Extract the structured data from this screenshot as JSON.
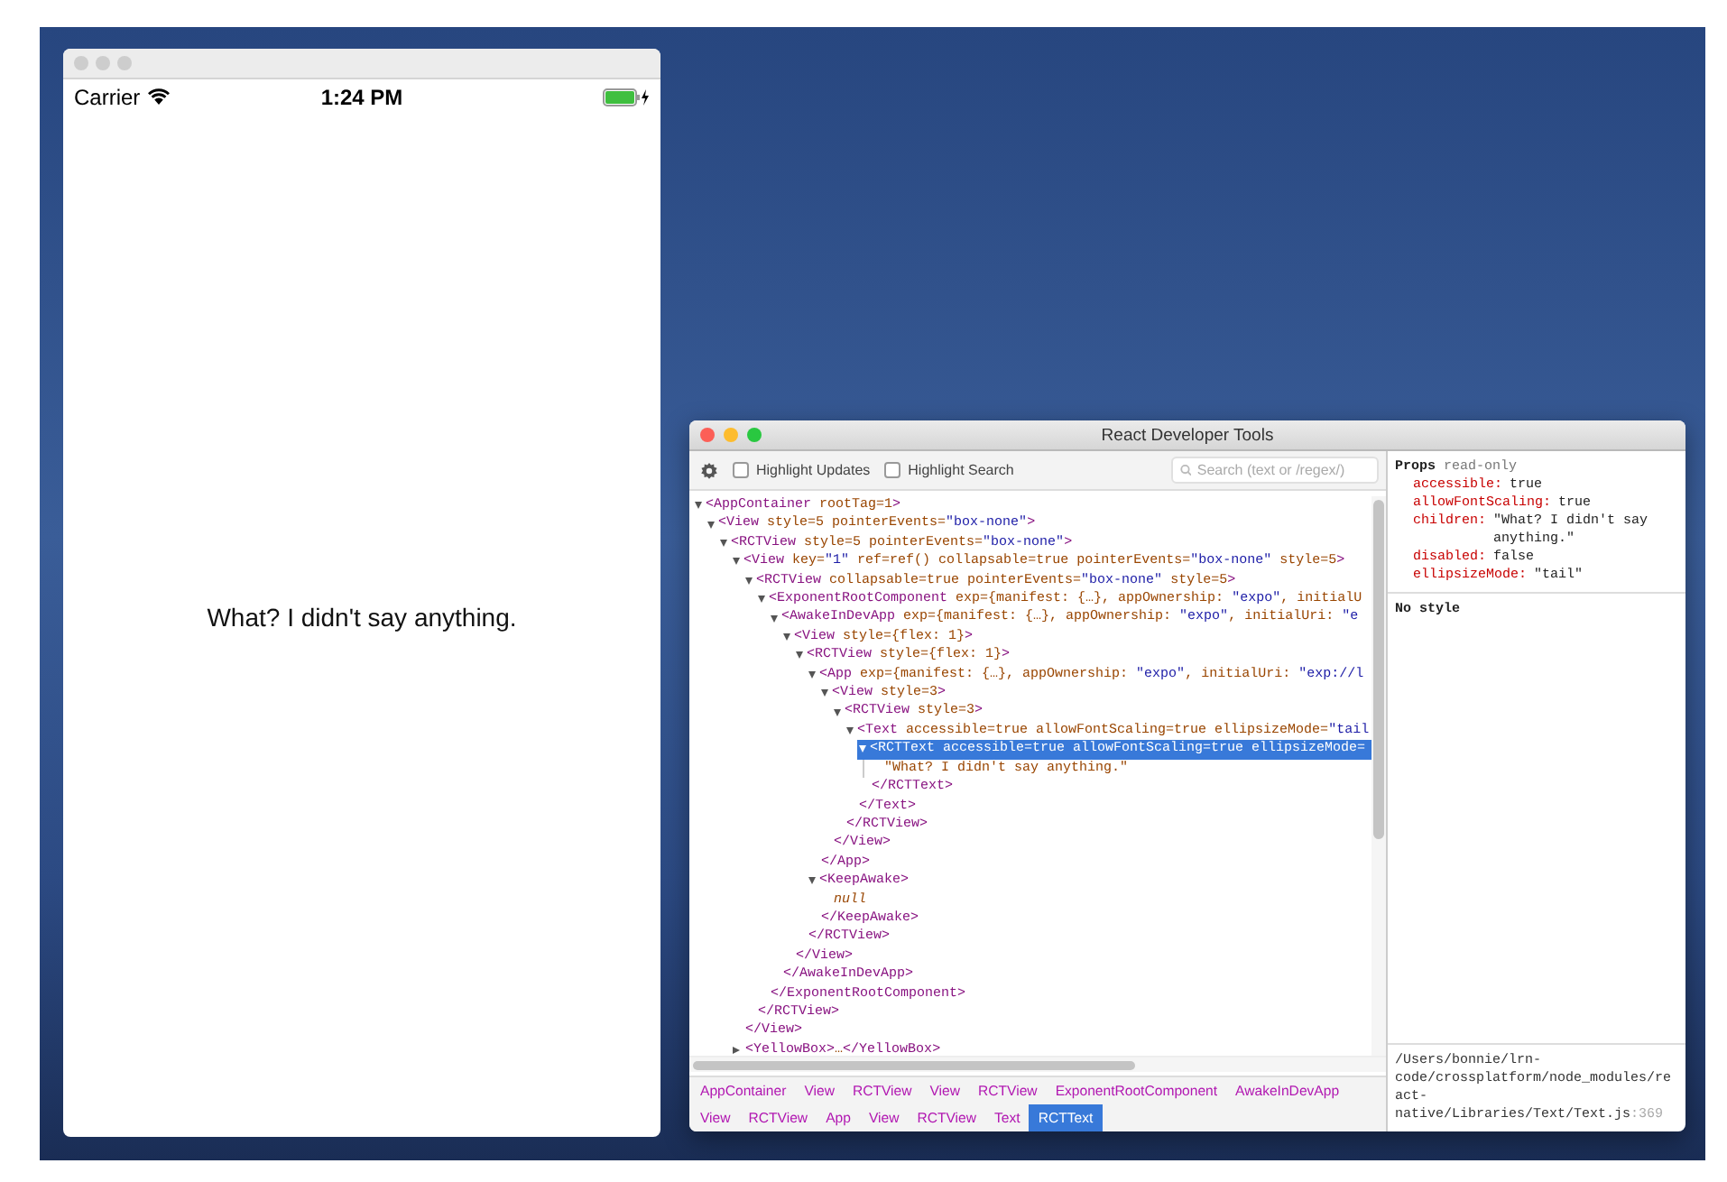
{
  "simulator": {
    "status_bar": {
      "carrier": "Carrier",
      "time": "1:24 PM"
    },
    "content_text": "What? I didn't say anything."
  },
  "devtools": {
    "window": {
      "title": "React Developer Tools"
    },
    "toolbar": {
      "checkboxes": [
        {
          "label": "Highlight Updates",
          "checked": false
        },
        {
          "label": "Highlight Search",
          "checked": false
        }
      ],
      "search": {
        "placeholder": "Search (text or /regex/)"
      }
    },
    "tree": [
      {
        "kind": "element",
        "open": "<AppContainer rootTag=1>",
        "expanded": true,
        "selected": false,
        "children": [
          {
            "kind": "element",
            "open": "<View style=5 pointerEvents=\"box-none\">",
            "expanded": true,
            "selected": false,
            "children": [
              {
                "kind": "element",
                "open": "<RCTView style=5 pointerEvents=\"box-none\">",
                "expanded": true,
                "selected": false,
                "children": [
                  {
                    "kind": "element",
                    "open": "<View key=\"1\" ref=ref() collapsable=true pointerEvents=\"box-none\" style=5>",
                    "expanded": true,
                    "selected": false,
                    "close": "</View>",
                    "children": [
                      {
                        "kind": "element",
                        "open": "<RCTView collapsable=true pointerEvents=\"box-none\" style=5>",
                        "expanded": true,
                        "selected": false,
                        "close": "</RCTView>",
                        "children": [
                          {
                            "kind": "element",
                            "open": "<ExponentRootComponent exp={manifest: {…}, appOwnership: \"expo\", initialU",
                            "expanded": true,
                            "selected": false,
                            "close": "</ExponentRootComponent>",
                            "children": [
                              {
                                "kind": "element",
                                "open": "<AwakeInDevApp exp={manifest: {…}, appOwnership: \"expo\", initialUri: \"e",
                                "expanded": true,
                                "selected": false,
                                "close": "</AwakeInDevApp>",
                                "children": [
                                  {
                                    "kind": "element",
                                    "open": "<View style={flex: 1}>",
                                    "expanded": true,
                                    "selected": false,
                                    "close": "</View>",
                                    "children": [
                                      {
                                        "kind": "element",
                                        "open": "<RCTView style={flex: 1}>",
                                        "expanded": true,
                                        "selected": false,
                                        "close": "</RCTView>",
                                        "children": [
                                          {
                                            "kind": "element",
                                            "open": "<App exp={manifest: {…}, appOwnership: \"expo\", initialUri: \"exp://l",
                                            "expanded": true,
                                            "selected": false,
                                            "close": "</App>",
                                            "children": [
                                              {
                                                "kind": "element",
                                                "open": "<View style=3>",
                                                "expanded": true,
                                                "selected": false,
                                                "close": "</View>",
                                                "children": [
                                                  {
                                                    "kind": "element",
                                                    "open": "<RCTView style=3>",
                                                    "expanded": true,
                                                    "selected": false,
                                                    "close": "</RCTView>",
                                                    "children": [
                                                      {
                                                        "kind": "element",
                                                        "open": "<Text accessible=true allowFontScaling=true ellipsizeMode=\"tail",
                                                        "expanded": true,
                                                        "selected": false,
                                                        "close": "</Text>",
                                                        "children": [
                                                          {
                                                            "kind": "element",
                                                            "open": "<RCTText accessible=true allowFontScaling=true ellipsizeMode=",
                                                            "expanded": true,
                                                            "selected": true,
                                                            "close": "</RCTText>",
                                                            "children": [
                                                              {
                                                                "kind": "text",
                                                                "text": "\"What? I didn't say anything.\""
                                                              }
                                                            ]
                                                          }
                                                        ]
                                                      }
                                                    ]
                                                  }
                                                ]
                                              }
                                            ]
                                          },
                                          {
                                            "kind": "element",
                                            "open": "<KeepAwake>",
                                            "expanded": true,
                                            "selected": false,
                                            "close": "</KeepAwake>",
                                            "children": [
                                              {
                                                "kind": "null",
                                                "text": "null"
                                              }
                                            ]
                                          }
                                        ]
                                      }
                                    ]
                                  }
                                ]
                              }
                            ]
                          }
                        ]
                      }
                    ]
                  },
                  {
                    "kind": "element",
                    "open": "<YellowBox>…</YellowBox>",
                    "expanded": false,
                    "selected": false
                  }
                ]
              }
            ]
          }
        ]
      }
    ],
    "breadcrumbs": [
      {
        "label": "AppContainer",
        "selected": false
      },
      {
        "label": "View",
        "selected": false
      },
      {
        "label": "RCTView",
        "selected": false
      },
      {
        "label": "View",
        "selected": false
      },
      {
        "label": "RCTView",
        "selected": false
      },
      {
        "label": "ExponentRootComponent",
        "selected": false
      },
      {
        "label": "AwakeInDevApp",
        "selected": false
      },
      {
        "label": "View",
        "selected": false
      },
      {
        "label": "RCTView",
        "selected": false
      },
      {
        "label": "App",
        "selected": false
      },
      {
        "label": "View",
        "selected": false
      },
      {
        "label": "RCTView",
        "selected": false
      },
      {
        "label": "Text",
        "selected": false
      },
      {
        "label": "RCTText",
        "selected": true
      }
    ],
    "props_panel": {
      "heading": "Props",
      "note": "read-only",
      "props": [
        {
          "name": "accessible:",
          "value": "true"
        },
        {
          "name": "allowFontScaling:",
          "value": "true"
        },
        {
          "name": "children:",
          "value": "\"What? I didn't say anything.\""
        },
        {
          "name": "disabled:",
          "value": "false"
        },
        {
          "name": "ellipsizeMode:",
          "value": "\"tail\""
        }
      ],
      "style_note": "No style",
      "source": {
        "path": "/Users/bonnie/lrn-code/crossplatform/node_modules/react-native/Libraries/Text/Text.js",
        "line": ":369"
      }
    }
  }
}
